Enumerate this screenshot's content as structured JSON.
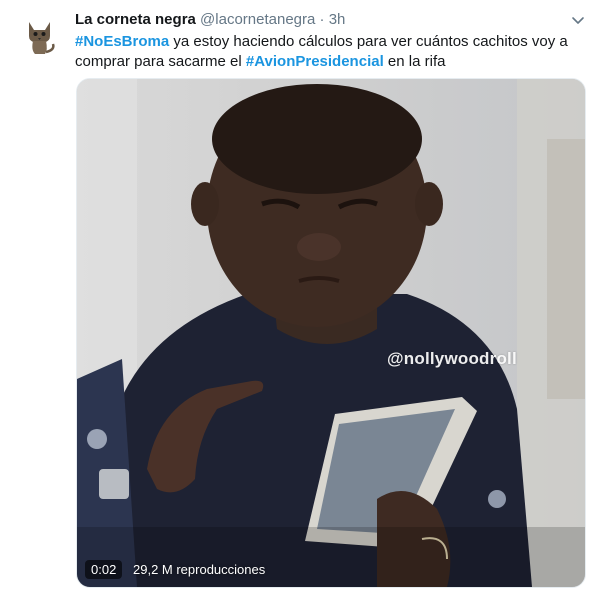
{
  "tweet": {
    "display_name": "La corneta negra",
    "handle": "@lacornetanegra",
    "separator": "·",
    "time": "3h",
    "text": {
      "hashtag1": "#NoEsBroma",
      "part1": " ya estoy haciendo cálculos para ver cuántos cachitos voy a comprar para sacarme el ",
      "hashtag2": "#AvionPresidencial",
      "part2": " en la rifa"
    },
    "icons": {
      "avatar": "cat-avatar",
      "menu": "chevron-down-icon"
    },
    "colors": {
      "hashtag": "#1b95e0",
      "name": "#14171a",
      "meta": "#657786"
    }
  },
  "media": {
    "watermark": "@nollywoodroll",
    "duration": "0:02",
    "views": "29,2 M reproducciones"
  }
}
